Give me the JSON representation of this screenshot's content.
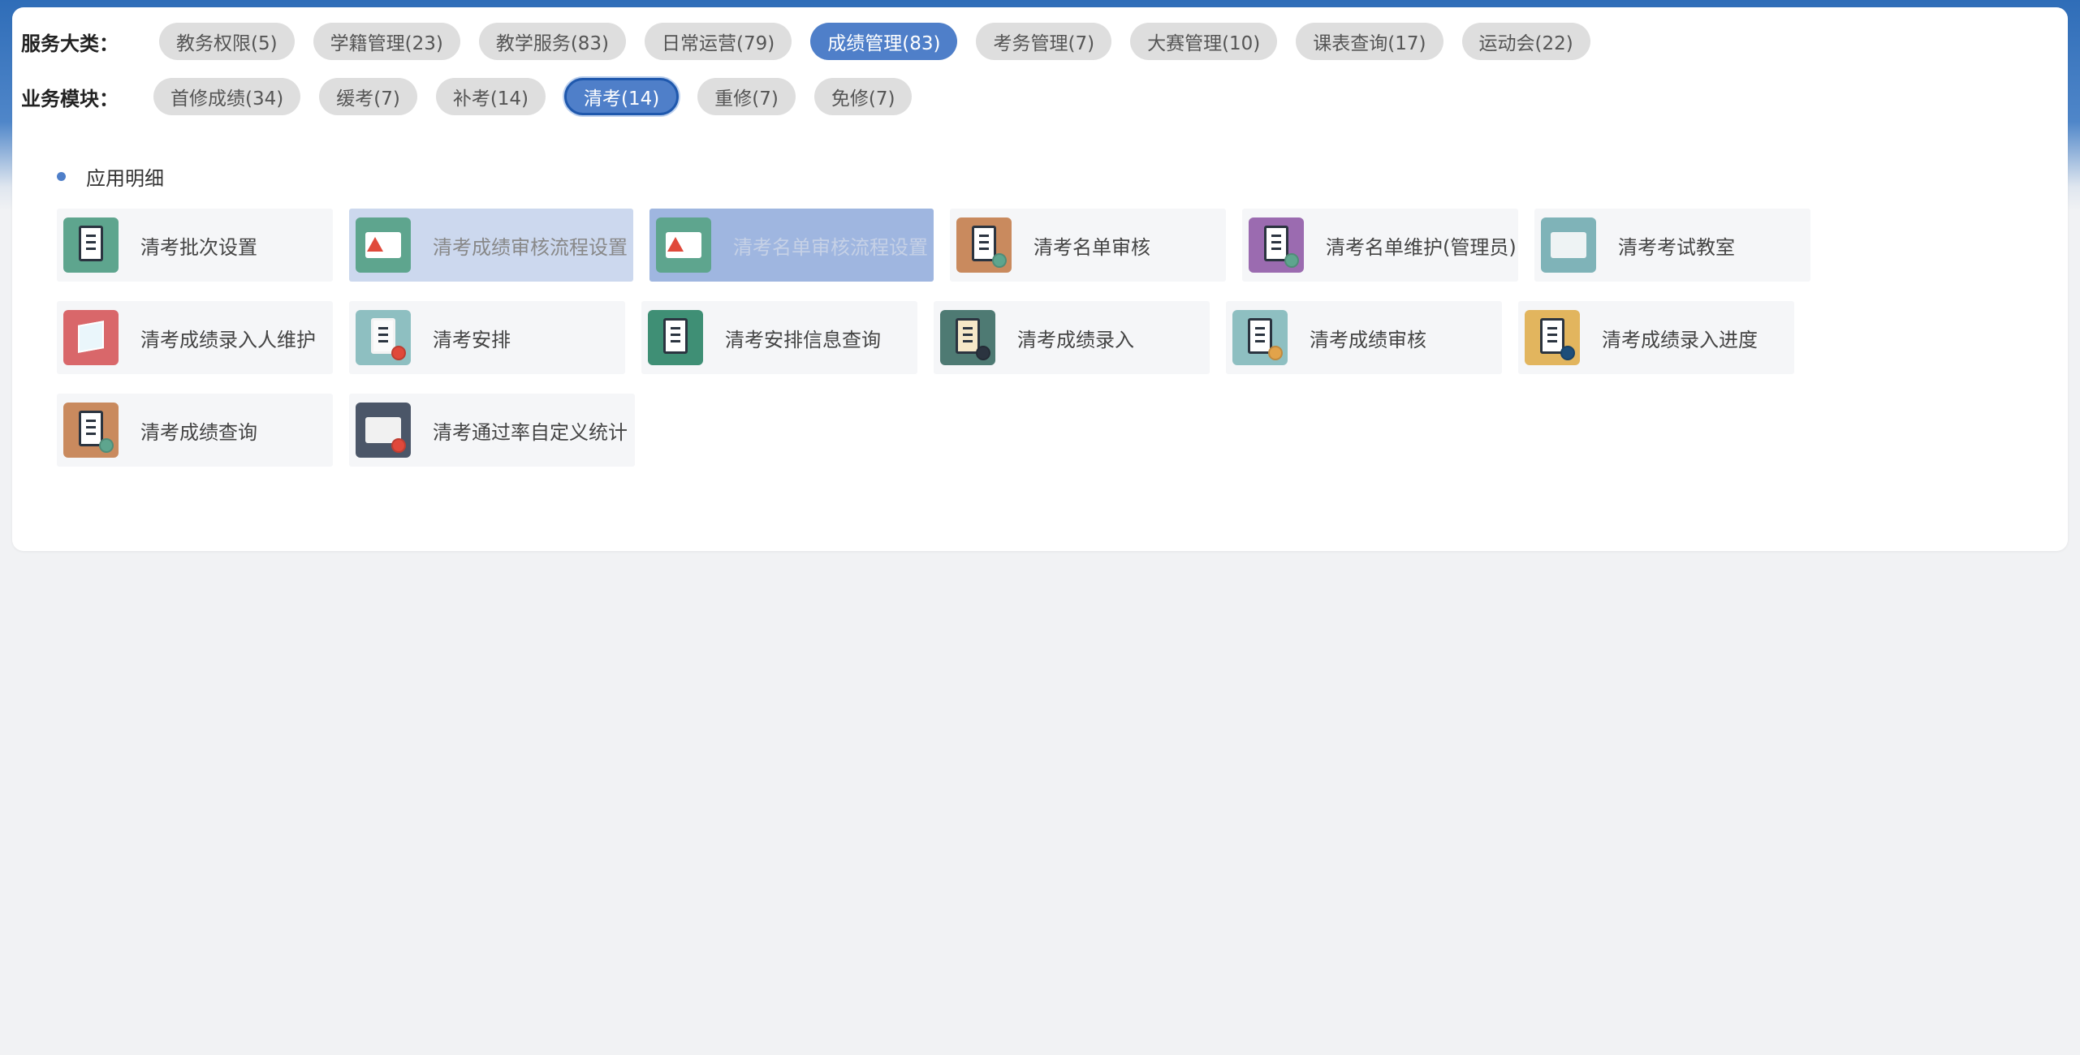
{
  "categories": {
    "label": "服务大类：",
    "items": [
      {
        "label": "教务权限(5)"
      },
      {
        "label": "学籍管理(23)"
      },
      {
        "label": "教学服务(83)"
      },
      {
        "label": "日常运营(79)"
      },
      {
        "label": "成绩管理(83)"
      },
      {
        "label": "考务管理(7)"
      },
      {
        "label": "大赛管理(10)"
      },
      {
        "label": "课表查询(17)"
      },
      {
        "label": "运动会(22)"
      }
    ],
    "active_index": 4
  },
  "modules": {
    "label": "业务模块：",
    "items": [
      {
        "label": "首修成绩(34)"
      },
      {
        "label": "缓考(7)"
      },
      {
        "label": "补考(14)"
      },
      {
        "label": "清考(14)"
      },
      {
        "label": "重修(7)"
      },
      {
        "label": "免修(7)"
      }
    ],
    "active_index": 3
  },
  "section": {
    "title": "应用明细"
  },
  "apps": [
    {
      "label": "清考批次设置",
      "icon": "clipboard-check-icon",
      "color": "#5ea58e"
    },
    {
      "label": "清考成绩审核流程设置",
      "icon": "workflow-warning-icon",
      "color": "#5ea58e"
    },
    {
      "label": "清考名单审核流程设置",
      "icon": "workflow-warning-icon",
      "color": "#5ea58e"
    },
    {
      "label": "清考名单审核",
      "icon": "clipboard-tool-icon",
      "color": "#c98a5e"
    },
    {
      "label": "清考名单维护(管理员)",
      "icon": "clipboard-tool-icon",
      "color": "#9b6bb0"
    },
    {
      "label": "清考考试教室",
      "icon": "classroom-icon",
      "color": "#7fb3b8"
    },
    {
      "label": "清考成绩录入人维护",
      "icon": "cube-icon",
      "color": "#d9676a"
    },
    {
      "label": "清考安排",
      "icon": "exam-paper-gear-icon",
      "color": "#8ebfc1"
    },
    {
      "label": "清考安排信息查询",
      "icon": "document-search-icon",
      "color": "#3f8f75"
    },
    {
      "label": "清考成绩录入",
      "icon": "score-sheet-tool-icon",
      "color": "#4e7a73"
    },
    {
      "label": "清考成绩审核",
      "icon": "clipboard-user-icon",
      "color": "#8ebfc1"
    },
    {
      "label": "清考成绩录入进度",
      "icon": "clipboard-pen-icon",
      "color": "#e2b55e"
    },
    {
      "label": "清考成绩查询",
      "icon": "clipboard-tool-icon",
      "color": "#c98a5e"
    },
    {
      "label": "清考通过率自定义统计",
      "icon": "statistics-icon",
      "color": "#4b5668"
    }
  ]
}
